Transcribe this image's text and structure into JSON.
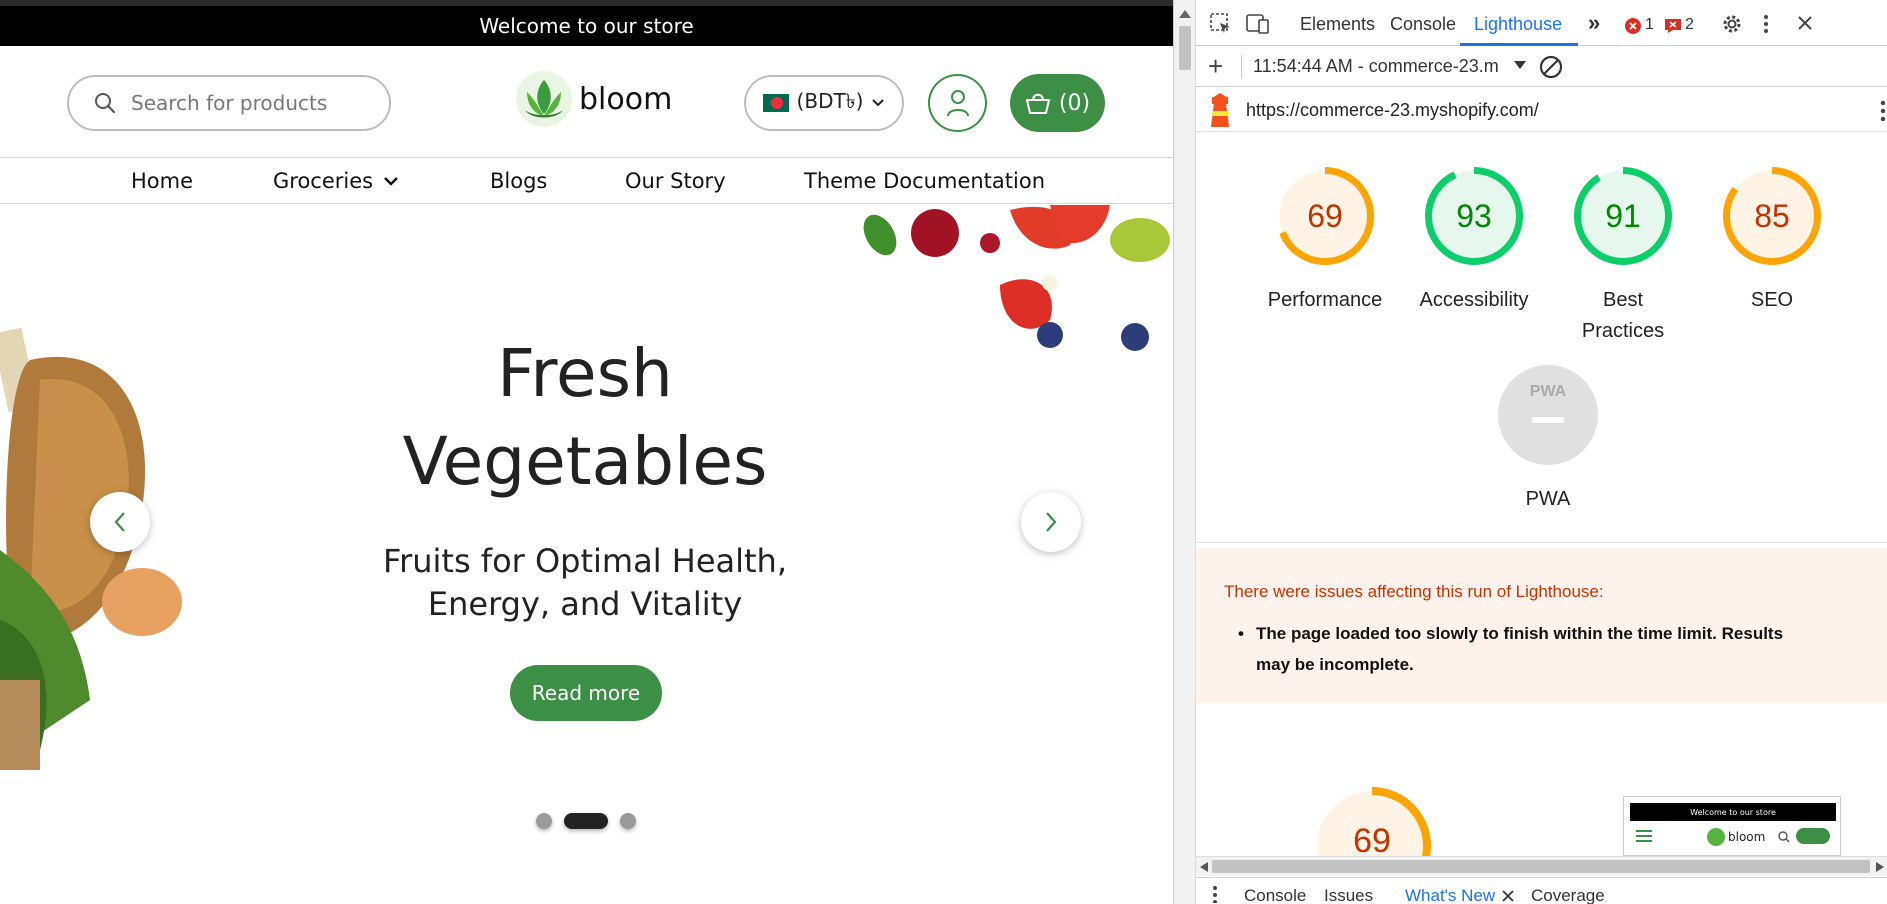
{
  "store": {
    "announcement": "Welcome to our store",
    "search_placeholder": "Search for products",
    "logo_text": "bloom",
    "currency": "(BDT৳)",
    "cart": "(0)",
    "nav": [
      "Home",
      "Groceries",
      "Blogs",
      "Our Story",
      "Theme Documentation"
    ],
    "hero": {
      "title_line1": "Fresh",
      "title_line2": "Vegetables",
      "subtitle_line1": "Fruits for Optimal Health,",
      "subtitle_line2": "Energy, and Vitality",
      "button": "Read more"
    },
    "slider_active_index": 1,
    "slider_count": 3
  },
  "devtools": {
    "tabs": [
      "Elements",
      "Console",
      "Lighthouse"
    ],
    "active_tab": "Lighthouse",
    "error_count": "1",
    "issue_count": "2",
    "report_time": "11:54:44 AM - commerce-23.m",
    "url": "https://commerce-23.myshopify.com/",
    "scores": [
      {
        "label": "Performance",
        "value": "69",
        "fraction": 0.69,
        "color": "#ffa400",
        "text_color": "#c33300",
        "bg": "#fff3e6"
      },
      {
        "label": "Accessibility",
        "value": "93",
        "fraction": 0.93,
        "color": "#0cce6b",
        "text_color": "#008800",
        "bg": "#e6f8ee"
      },
      {
        "label_line1": "Best",
        "label_line2": "Practices",
        "value": "91",
        "fraction": 0.91,
        "color": "#0cce6b",
        "text_color": "#008800",
        "bg": "#e6f8ee"
      },
      {
        "label": "SEO",
        "value": "85",
        "fraction": 0.85,
        "color": "#ffa400",
        "text_color": "#c33300",
        "bg": "#fff3e6"
      }
    ],
    "pwa_label": "PWA",
    "pwa_badge": "PWA",
    "warning_title": "There were issues affecting this run of Lighthouse:",
    "warning_item_line1": "The page loaded too slowly to finish within the time limit. Results",
    "warning_item_line2": "may be incomplete.",
    "bottom_score": "69",
    "thumb_banner": "Welcome to our store",
    "thumb_logo": "bloom",
    "drawer_tabs": [
      "Console",
      "Issues",
      "What's New",
      "Coverage"
    ],
    "drawer_active": "What's New"
  }
}
